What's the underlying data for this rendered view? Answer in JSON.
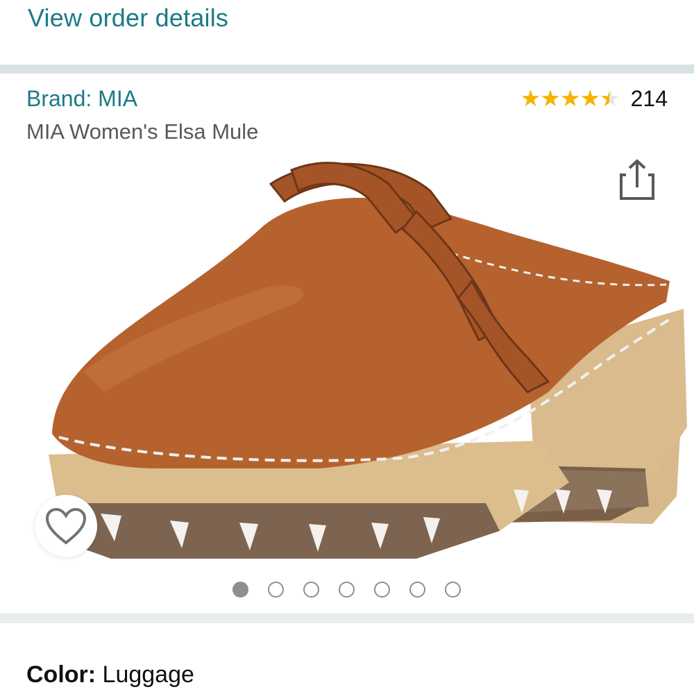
{
  "order_link": "View order details",
  "product": {
    "brand": "Brand: MIA",
    "title": "MIA Women's Elsa Mule",
    "rating_value": 4.5,
    "rating_stars": "★★★★★",
    "rating_count": "214",
    "share_icon": "share-icon",
    "favorite_icon": "heart-icon"
  },
  "carousel": {
    "total": 7,
    "active_index": 0
  },
  "color": {
    "label": "Color:",
    "value": "Luggage"
  },
  "colors": {
    "link": "#1b7a87",
    "star": "#f5b400",
    "leather": "#b5622f",
    "wood": "#d8b98b"
  }
}
